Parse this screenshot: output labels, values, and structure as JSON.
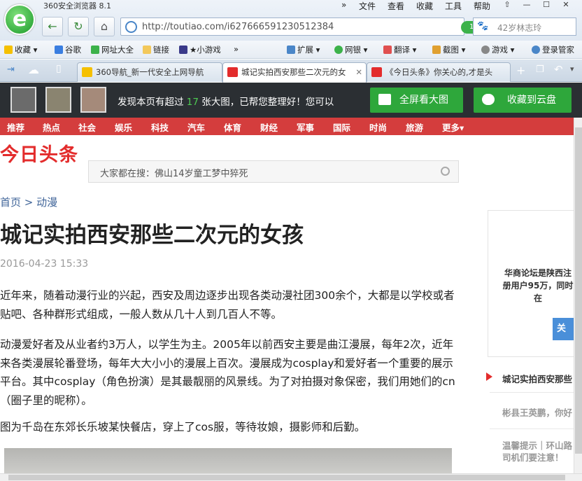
{
  "browser": {
    "app_name": "360安全浏览器 8.1",
    "menu": [
      "文件",
      "查看",
      "收藏",
      "工具",
      "帮助"
    ],
    "url": "http://toutiao.com/i627666591230512384",
    "image_badge": "17张大图",
    "search_placeholder": "42岁林志玲",
    "bookmarks": [
      "收藏",
      "谷歌",
      "网址大全",
      "链接",
      "★小游戏",
      "扩展",
      "网银",
      "翻译",
      "截图",
      "游戏",
      "登录管家"
    ],
    "tabs": [
      {
        "label": "360导航_新一代安全上网导航",
        "active": false
      },
      {
        "label": "城记实拍西安那些二次元的女",
        "active": true
      },
      {
        "label": "《今日头条》你关心的,才是头",
        "active": false
      }
    ]
  },
  "gallery_bar": {
    "message_prefix": "发现本页有超过",
    "count": "17",
    "message_suffix": "张大图，已帮您整理好！您可以",
    "fullscreen_button": "全屏看大图",
    "cloud_button": "收藏到云盘"
  },
  "channels": [
    "推荐",
    "热点",
    "社会",
    "娱乐",
    "科技",
    "汽车",
    "体育",
    "财经",
    "军事",
    "国际",
    "时尚",
    "旅游",
    "更多▾"
  ],
  "site": {
    "brand": "今日头条",
    "hot_search": "大家都在搜：佛山14岁童工梦中猝死",
    "breadcrumb": "首页 > 动漫"
  },
  "article": {
    "title": "城记实拍西安那些二次元的女孩",
    "date": "2016-04-23 15:33",
    "paragraphs": [
      "近年来，随着动漫行业的兴起，西安及周边逐步出现各类动漫社团300余个，大都是以学校或者贴吧、各种群形式组成，一般人数从几十人到几百人不等。",
      "动漫爱好者及从业者约3万人，以学生为主。2005年以前西安主要是曲江漫展，每年2次，近年来各类漫展轮番登场，每年大大小小的漫展上百次。漫展成为cosplay和爱好者一个重要的展示平台。其中cosplay（角色扮演）是其最靓丽的风景线。为了对拍摄对象保密，我们用她们的cn（圈子里的昵称）。",
      "图为千岛在东郊长乐坡某快餐店，穿上了cos服，等待妆娘，摄影师和后勤。"
    ]
  },
  "sidebar": {
    "promo": "华商论坛是陕西注册用户95万，同时在",
    "promo_button": "关",
    "items": [
      "城记实拍西安那些",
      "彬县王英鹏，你好",
      "温馨提示｜环山路司机们要注意！"
    ]
  }
}
